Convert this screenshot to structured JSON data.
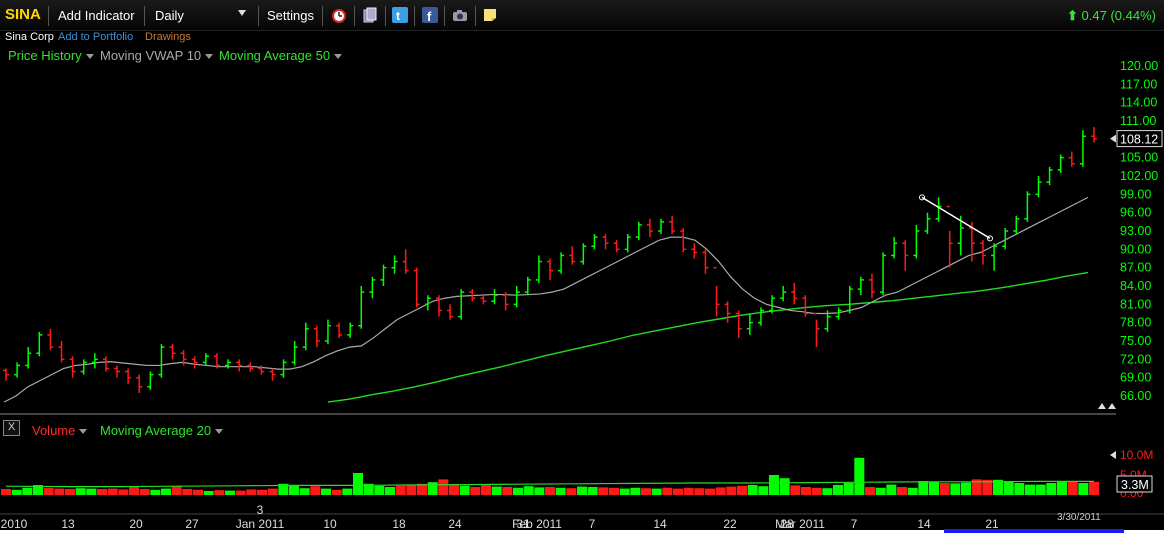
{
  "toolbar": {
    "symbol": "SINA",
    "add_indicator": "Add Indicator",
    "period": "Daily",
    "settings": "Settings",
    "change_value": "0.47",
    "change_pct": "(0.44%)",
    "icons": [
      "alarm-clock-icon",
      "documents-icon",
      "twitter-icon",
      "facebook-icon",
      "camera-icon",
      "note-icon"
    ]
  },
  "subheader": {
    "company": "Sina Corp",
    "add_to_portfolio": "Add to Portfolio",
    "drawings": "Drawings"
  },
  "legend": {
    "price_history": "Price History",
    "vwap": "Moving VWAP 10",
    "ma50": "Moving Average 50"
  },
  "volume_legend": {
    "close": "X",
    "volume": "Volume",
    "ma20": "Moving Average 20"
  },
  "colors": {
    "up": "#00ff00",
    "down": "#ff1a1a",
    "vwap": "#aaaaaa",
    "ma50": "#22dd22",
    "axis_text": "#00ff00"
  },
  "chart_data": {
    "type": "candlestick",
    "price_axis": {
      "ylim": [
        64.0,
        121.0
      ],
      "ticks": [
        "120.00",
        "117.00",
        "114.00",
        "111.00",
        "108.00",
        "105.00",
        "102.00",
        "99.00",
        "96.00",
        "93.00",
        "90.00",
        "87.00",
        "84.00",
        "81.00",
        "78.00",
        "75.00",
        "72.00",
        "69.00",
        "66.00"
      ],
      "last_price_label": "108.12"
    },
    "volume_axis": {
      "ticks": [
        "10.0M",
        "5.0M",
        "0.00"
      ],
      "current_label": "3.3M"
    },
    "x_labels": [
      "2010",
      "13",
      "20",
      "27",
      "Jan 2011",
      "3",
      "10",
      "18",
      "24",
      "31",
      "Feb 2011",
      "7",
      "14",
      "22",
      "28",
      "Mar 2011",
      "7",
      "14",
      "21",
      "3/30/2011"
    ],
    "series": [
      {
        "name": "Price History",
        "bars": [
          [
            70.2,
            69.5,
            70.5,
            68.5
          ],
          [
            69.5,
            71.0,
            71.5,
            69.0
          ],
          [
            71.0,
            73.0,
            74.0,
            70.5
          ],
          [
            73.0,
            76.0,
            76.5,
            72.5
          ],
          [
            76.0,
            74.0,
            77.0,
            73.5
          ],
          [
            74.0,
            72.0,
            75.0,
            71.5
          ],
          [
            72.0,
            70.0,
            72.5,
            69.0
          ],
          [
            70.0,
            71.5,
            72.0,
            69.5
          ],
          [
            71.5,
            72.0,
            73.0,
            70.5
          ],
          [
            72.0,
            70.5,
            72.5,
            70.0
          ],
          [
            70.5,
            70.0,
            71.0,
            69.0
          ],
          [
            70.0,
            69.0,
            70.5,
            68.0
          ],
          [
            69.0,
            67.5,
            69.5,
            66.5
          ],
          [
            67.5,
            69.5,
            70.0,
            67.0
          ],
          [
            69.5,
            74.0,
            74.5,
            69.0
          ],
          [
            74.0,
            73.0,
            74.5,
            72.0
          ],
          [
            73.0,
            72.0,
            73.5,
            71.0
          ],
          [
            72.0,
            71.5,
            72.5,
            70.5
          ],
          [
            71.5,
            72.5,
            73.0,
            71.0
          ],
          [
            72.5,
            71.0,
            73.0,
            70.5
          ],
          [
            71.0,
            71.5,
            72.0,
            70.5
          ],
          [
            71.5,
            71.0,
            72.0,
            70.0
          ],
          [
            71.0,
            70.5,
            71.5,
            70.0
          ],
          [
            70.5,
            70.0,
            71.0,
            69.5
          ],
          [
            70.0,
            69.5,
            70.5,
            68.5
          ],
          [
            69.5,
            71.5,
            72.0,
            69.0
          ],
          [
            71.5,
            74.0,
            75.0,
            71.0
          ],
          [
            74.0,
            77.0,
            78.0,
            73.5
          ],
          [
            77.0,
            75.0,
            77.5,
            74.0
          ],
          [
            75.0,
            77.5,
            78.5,
            74.5
          ],
          [
            77.5,
            76.0,
            78.0,
            75.5
          ],
          [
            76.0,
            77.5,
            78.0,
            75.5
          ],
          [
            77.5,
            83.0,
            84.0,
            77.0
          ],
          [
            83.0,
            85.0,
            85.5,
            82.0
          ],
          [
            85.0,
            87.0,
            87.5,
            84.0
          ],
          [
            87.0,
            88.0,
            89.0,
            86.0
          ],
          [
            88.0,
            86.5,
            90.0,
            86.0
          ],
          [
            86.5,
            81.0,
            87.0,
            80.5
          ],
          [
            81.0,
            82.0,
            82.5,
            80.0
          ],
          [
            82.0,
            80.0,
            82.5,
            79.0
          ],
          [
            80.0,
            79.0,
            81.0,
            78.5
          ],
          [
            79.0,
            83.0,
            83.5,
            78.5
          ],
          [
            83.0,
            82.0,
            83.5,
            81.5
          ],
          [
            82.0,
            81.5,
            82.5,
            81.0
          ],
          [
            81.5,
            82.5,
            83.5,
            81.0
          ],
          [
            82.5,
            81.0,
            83.0,
            80.0
          ],
          [
            81.0,
            83.0,
            84.0,
            80.5
          ],
          [
            83.0,
            85.0,
            85.5,
            82.5
          ],
          [
            85.0,
            88.0,
            89.0,
            84.5
          ],
          [
            88.0,
            86.5,
            88.5,
            85.0
          ],
          [
            86.5,
            89.0,
            89.5,
            86.0
          ],
          [
            89.0,
            88.0,
            90.5,
            87.5
          ],
          [
            88.0,
            90.5,
            91.0,
            87.5
          ],
          [
            90.5,
            92.0,
            92.5,
            90.0
          ],
          [
            92.0,
            91.0,
            92.5,
            90.0
          ],
          [
            91.0,
            90.0,
            91.5,
            89.5
          ],
          [
            90.0,
            92.0,
            92.5,
            89.5
          ],
          [
            92.0,
            94.0,
            94.5,
            91.5
          ],
          [
            94.0,
            93.0,
            95.0,
            92.0
          ],
          [
            93.0,
            94.5,
            95.0,
            92.5
          ],
          [
            94.5,
            93.0,
            95.5,
            92.5
          ],
          [
            93.0,
            90.0,
            93.5,
            89.5
          ],
          [
            90.0,
            89.5,
            91.0,
            88.5
          ],
          [
            89.5,
            87.0,
            90.0,
            86.0
          ],
          [
            87.0,
            81.0,
            84.0,
            79.0
          ],
          [
            81.0,
            79.5,
            81.5,
            78.0
          ],
          [
            79.5,
            77.0,
            80.0,
            75.5
          ],
          [
            77.0,
            78.0,
            79.5,
            76.0
          ],
          [
            78.0,
            80.0,
            80.5,
            77.5
          ],
          [
            80.0,
            82.0,
            82.5,
            79.5
          ],
          [
            82.0,
            83.0,
            84.0,
            81.5
          ],
          [
            83.0,
            82.0,
            84.5,
            81.0
          ],
          [
            82.0,
            79.5,
            82.5,
            79.0
          ],
          [
            79.5,
            77.0,
            78.5,
            74.0
          ],
          [
            77.0,
            79.0,
            80.0,
            76.5
          ],
          [
            79.0,
            80.0,
            80.5,
            78.5
          ],
          [
            80.0,
            83.5,
            84.0,
            79.5
          ],
          [
            83.5,
            85.0,
            85.5,
            82.5
          ],
          [
            85.0,
            83.0,
            86.0,
            82.0
          ],
          [
            83.0,
            89.0,
            89.5,
            82.5
          ],
          [
            89.0,
            91.0,
            92.0,
            88.5
          ],
          [
            91.0,
            89.0,
            91.5,
            86.5
          ],
          [
            89.0,
            93.0,
            94.0,
            88.5
          ],
          [
            93.0,
            95.0,
            96.0,
            92.5
          ],
          [
            95.0,
            97.0,
            98.5,
            94.5
          ],
          [
            97.0,
            91.0,
            93.0,
            87.0
          ],
          [
            91.0,
            93.5,
            95.5,
            89.0
          ],
          [
            93.5,
            91.0,
            94.5,
            88.0
          ],
          [
            91.0,
            89.0,
            91.5,
            87.5
          ],
          [
            89.0,
            90.5,
            91.0,
            86.5
          ],
          [
            90.5,
            93.0,
            93.5,
            90.0
          ],
          [
            93.0,
            95.0,
            95.5,
            92.5
          ],
          [
            95.0,
            99.0,
            99.5,
            94.5
          ],
          [
            99.0,
            101.0,
            102.0,
            98.5
          ],
          [
            101.0,
            103.0,
            103.5,
            100.5
          ],
          [
            103.0,
            105.0,
            105.5,
            102.5
          ],
          [
            105.0,
            104.0,
            106.0,
            103.5
          ],
          [
            104.0,
            108.5,
            109.5,
            103.5
          ],
          [
            108.5,
            108.1,
            110.0,
            107.5
          ]
        ]
      },
      {
        "name": "Moving VWAP 10",
        "values": [
          65,
          66,
          67.5,
          68.5,
          69.5,
          70.5,
          71.0,
          71.2,
          71.5,
          71.6,
          71.4,
          71.2,
          71.0,
          71.0,
          71.3,
          71.5,
          71.2,
          71.0,
          70.8,
          70.8,
          70.8,
          70.8,
          70.6,
          70.4,
          70.4,
          70.8,
          71.6,
          72.6,
          73.4,
          74.0,
          74.2,
          75.5,
          77.0,
          78.5,
          79.5,
          80.5,
          81.5,
          82.0,
          82.3,
          82.4,
          82.5,
          82.6,
          82.6,
          82.5,
          82.6,
          82.7,
          83.0,
          83.5,
          84.5,
          85.5,
          86.5,
          87.5,
          88.5,
          89.5,
          90.5,
          91.5,
          92.0,
          92.0,
          91.5,
          90.0,
          88.0,
          85.5,
          83.5,
          82.0,
          81.0,
          80.5,
          80.0,
          79.8,
          79.5,
          79.5,
          79.6,
          80.0,
          80.5,
          81.5,
          82.5,
          83.0,
          84.0,
          85.0,
          86.0,
          87.0,
          88.0,
          89.0,
          89.5,
          90.5,
          91.5,
          92.5,
          93.5,
          94.5,
          95.5,
          96.5,
          97.5,
          98.5
        ]
      },
      {
        "name": "Moving Average 50",
        "values": [
          65.0,
          65.5,
          66.2,
          66.8,
          67.5,
          68.3,
          69.2,
          70.0,
          70.8,
          71.7,
          72.6,
          73.4,
          74.2,
          75.0,
          75.9,
          76.6,
          77.3,
          78.0,
          78.6,
          79.2,
          79.7,
          80.1,
          80.5,
          80.8,
          81.0,
          81.3,
          81.6,
          82.0,
          82.4,
          82.8,
          83.2,
          83.7,
          84.3,
          84.9,
          85.6,
          86.2
        ]
      },
      {
        "name": "Volume",
        "values_m": [
          1.5,
          1.3,
          1.8,
          2.5,
          1.8,
          1.6,
          1.5,
          1.7,
          1.6,
          1.5,
          1.6,
          1.4,
          2.2,
          1.5,
          1.3,
          1.6,
          2.3,
          1.5,
          1.3,
          1.0,
          1.2,
          1.1,
          1.1,
          1.4,
          1.3,
          1.6,
          2.8,
          2.3,
          1.7,
          2.2,
          1.6,
          1.3,
          1.6,
          5.5,
          2.8,
          2.3,
          2.0,
          2.3,
          2.6,
          2.8,
          3.2,
          3.9,
          2.6,
          2.3,
          2.0,
          2.6,
          2.1,
          2.0,
          1.8,
          2.2,
          1.9,
          2.0,
          1.8,
          1.7,
          2.1,
          2.0,
          1.9,
          1.8,
          1.6,
          1.8,
          1.7,
          1.6,
          1.8,
          1.6,
          1.8,
          1.7,
          1.6,
          1.9,
          2.1,
          2.3,
          2.5,
          2.2,
          5.0,
          4.2,
          2.4,
          2.0,
          1.8,
          1.7,
          2.5,
          3.0,
          9.3,
          2.0,
          1.8,
          2.6,
          2.0,
          1.8,
          3.5,
          3.3,
          3.0,
          2.9,
          3.1,
          3.9,
          3.8,
          3.8,
          3.5,
          3.0,
          2.6,
          2.6,
          3.0,
          3.3,
          3.3,
          3.0,
          3.3
        ]
      },
      {
        "name": "Moving Average 20",
        "values_m": [
          2.2,
          2.1,
          2.1,
          2.2,
          2.3,
          2.4,
          2.4,
          2.5,
          2.6,
          2.7,
          2.8,
          2.9,
          3.0,
          3.0,
          3.1,
          3.2,
          3.3,
          3.3,
          3.4,
          3.4
        ]
      }
    ]
  }
}
